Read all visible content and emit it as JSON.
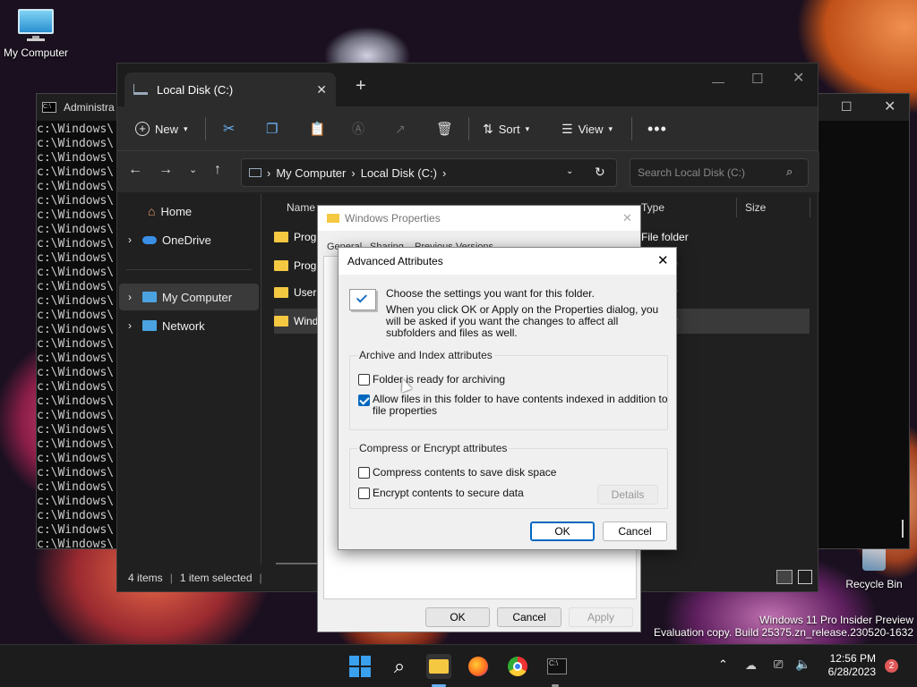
{
  "desktop": {
    "my_computer_label": "My Computer",
    "recycle_bin_label": "Recycle Bin",
    "watermark_line1": "Windows 11 Pro Insider Preview",
    "watermark_line2": "Evaluation copy. Build 25375.zn_release.230520-1632"
  },
  "cmd": {
    "title": "Administra",
    "lines": [
      "c:\\Windows\\",
      "c:\\Windows\\",
      "c:\\Windows\\",
      "c:\\Windows\\",
      "c:\\Windows\\",
      "c:\\Windows\\",
      "c:\\Windows\\",
      "c:\\Windows\\",
      "c:\\Windows\\",
      "c:\\Windows\\",
      "c:\\Windows\\",
      "c:\\Windows\\",
      "c:\\Windows\\",
      "c:\\Windows\\",
      "c:\\Windows\\",
      "c:\\Windows\\",
      "c:\\Windows\\",
      "c:\\Windows\\",
      "c:\\Windows\\",
      "c:\\Windows\\",
      "c:\\Windows\\",
      "c:\\Windows\\",
      "c:\\Windows\\",
      "c:\\Windows\\",
      "c:\\Windows\\",
      "c:\\Windows\\",
      "c:\\Windows\\",
      "c:\\Windows\\",
      "c:\\Windows\\",
      "c:\\Windows\\"
    ]
  },
  "explorer": {
    "tab_title": "Local Disk (C:)",
    "toolbar": {
      "new_label": "New",
      "sort_label": "Sort",
      "view_label": "View"
    },
    "breadcrumb": [
      "My Computer",
      "Local Disk (C:)"
    ],
    "search_placeholder": "Search Local Disk (C:)",
    "nav": [
      "Home",
      "OneDrive",
      "My Computer",
      "Network"
    ],
    "columns": {
      "name": "Name",
      "type": "Type",
      "size": "Size"
    },
    "rows": [
      {
        "name": "Prog",
        "type": "File folder"
      },
      {
        "name": "Prog",
        "type": "er"
      },
      {
        "name": "Users",
        "type": "er"
      },
      {
        "name": "Wind",
        "type": "er"
      }
    ],
    "status_items": "4 items",
    "status_selected": "1 item selected"
  },
  "properties": {
    "title": "Windows Properties",
    "tabs": [
      "General",
      "Sharing",
      "Previous Versions"
    ],
    "ok": "OK",
    "cancel": "Cancel",
    "apply": "Apply"
  },
  "advanced": {
    "title": "Advanced Attributes",
    "heading": "Choose the settings you want for this folder.",
    "description": "When you click OK or Apply on the Properties dialog, you will be asked if you want the changes to affect all subfolders and files as well.",
    "archive_group": "Archive and Index attributes",
    "archive_label": "Folder is ready for archiving",
    "index_label": "Allow files in this folder to have contents indexed in addition to file properties",
    "archive_checked": false,
    "index_checked": true,
    "compress_group": "Compress or Encrypt attributes",
    "compress_label": "Compress contents to save disk space",
    "encrypt_label": "Encrypt contents to secure data",
    "details": "Details",
    "ok": "OK",
    "cancel": "Cancel"
  },
  "taskbar": {
    "time": "12:56 PM",
    "date": "6/28/2023",
    "notification_count": "2"
  }
}
